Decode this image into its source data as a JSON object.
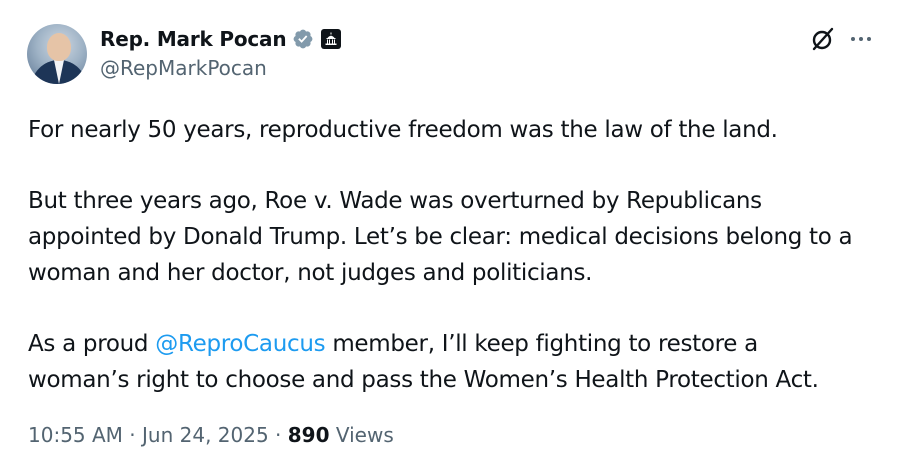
{
  "author": {
    "display_name": "Rep. Mark Pocan",
    "handle": "@RepMarkPocan",
    "avatar_icon": "profile-photo",
    "verified_icon": "verified-badge-icon",
    "affiliation_icon": "capitol-building-icon"
  },
  "actions": {
    "grok_icon": "grok-icon",
    "more_icon": "more-options-icon"
  },
  "tweet": {
    "p1": "For nearly 50 years, reproductive freedom was the law of the land.",
    "p2_line1": "But three years ago, Roe v. Wade was overturned by Republicans",
    "p2_line2": "appointed by Donald Trump. Let’s be clear: medical decisions belong to a",
    "p2_line3": "woman and her doctor, not judges and politicians.",
    "p3_before": "As a proud ",
    "p3_mention": "@ReproCaucus",
    "p3_after": " member, I’ll keep fighting to restore a",
    "p3_line2": "woman’s right to choose and pass the Women’s Health Protection Act."
  },
  "meta": {
    "time": "10:55 AM",
    "sep1": " · ",
    "date": "Jun 24, 2025",
    "sep2": " · ",
    "views_count": "890",
    "views_label": " Views"
  },
  "colors": {
    "text": "#0f1419",
    "secondary": "#536471",
    "link": "#1d9bf0",
    "verified": "#829aab"
  }
}
